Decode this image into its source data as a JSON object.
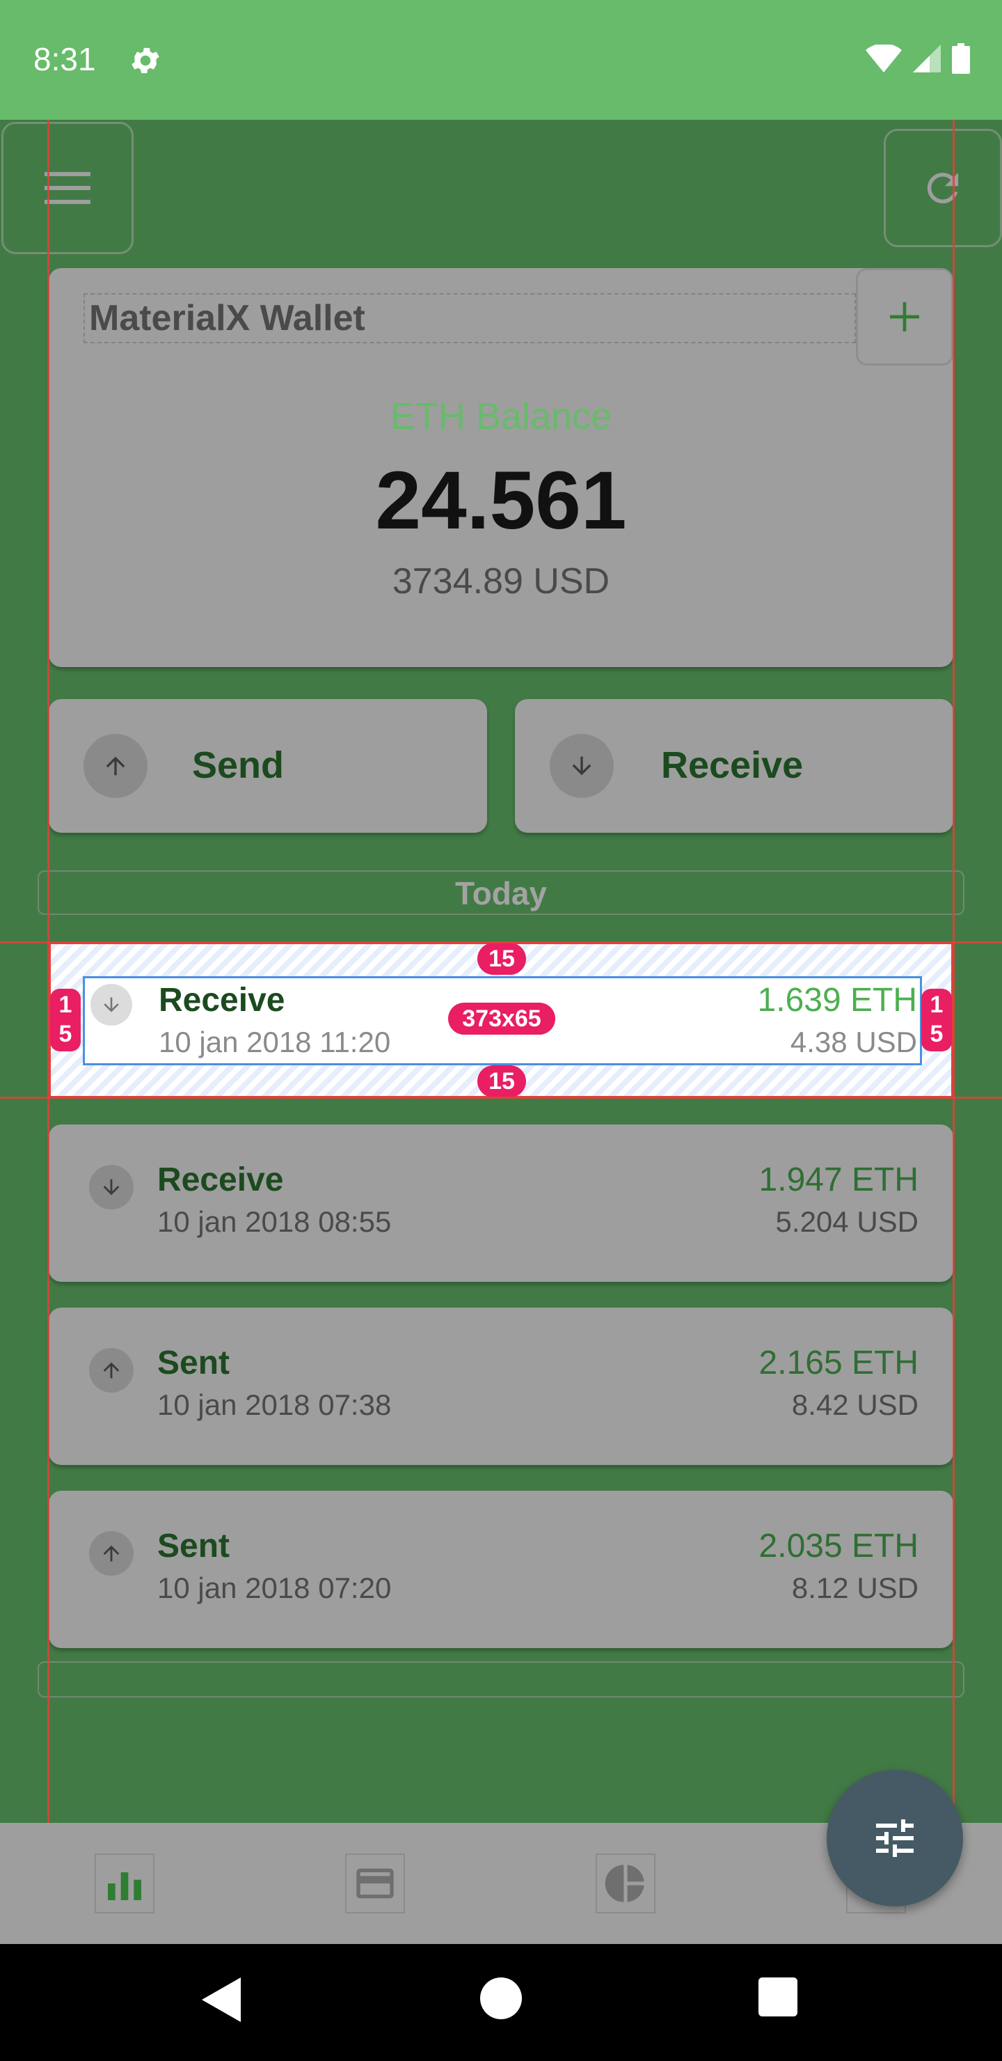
{
  "status_bar": {
    "time": "8:31"
  },
  "wallet": {
    "title": "MaterialX Wallet",
    "balance_label": "ETH Balance",
    "balance_value": "24.561",
    "balance_usd": "3734.89 USD"
  },
  "actions": {
    "send_label": "Send",
    "receive_label": "Receive"
  },
  "section_header": "Today",
  "transactions": [
    {
      "title": "Receive",
      "date": "10 jan 2018 11:20",
      "amount": "1.639 ETH",
      "usd": "4.38 USD",
      "direction": "down"
    },
    {
      "title": "Receive",
      "date": "10 jan 2018 08:55",
      "amount": "1.947 ETH",
      "usd": "5.204 USD",
      "direction": "down"
    },
    {
      "title": "Sent",
      "date": "10 jan 2018 07:38",
      "amount": "2.165 ETH",
      "usd": "8.42 USD",
      "direction": "up"
    },
    {
      "title": "Sent",
      "date": "10 jan 2018 07:20",
      "amount": "2.035 ETH",
      "usd": "8.12 USD",
      "direction": "up"
    }
  ],
  "inspector": {
    "padding_top": "15",
    "padding_bottom": "15",
    "padding_left": "15",
    "padding_right": "15",
    "size_badge": "373x65"
  },
  "bottom_nav": [
    {
      "icon": "bar-chart-icon"
    },
    {
      "icon": "credit-card-icon"
    },
    {
      "icon": "pie-chart-icon"
    },
    {
      "icon": "more-icon"
    }
  ],
  "fab": {
    "icon": "tune-icon"
  },
  "colors": {
    "status_bar": "#67bb6a",
    "background": "#427a45",
    "accent": "#4caf50",
    "fab": "#455a64",
    "guides": "#e0413b",
    "badge": "#e91e63"
  }
}
